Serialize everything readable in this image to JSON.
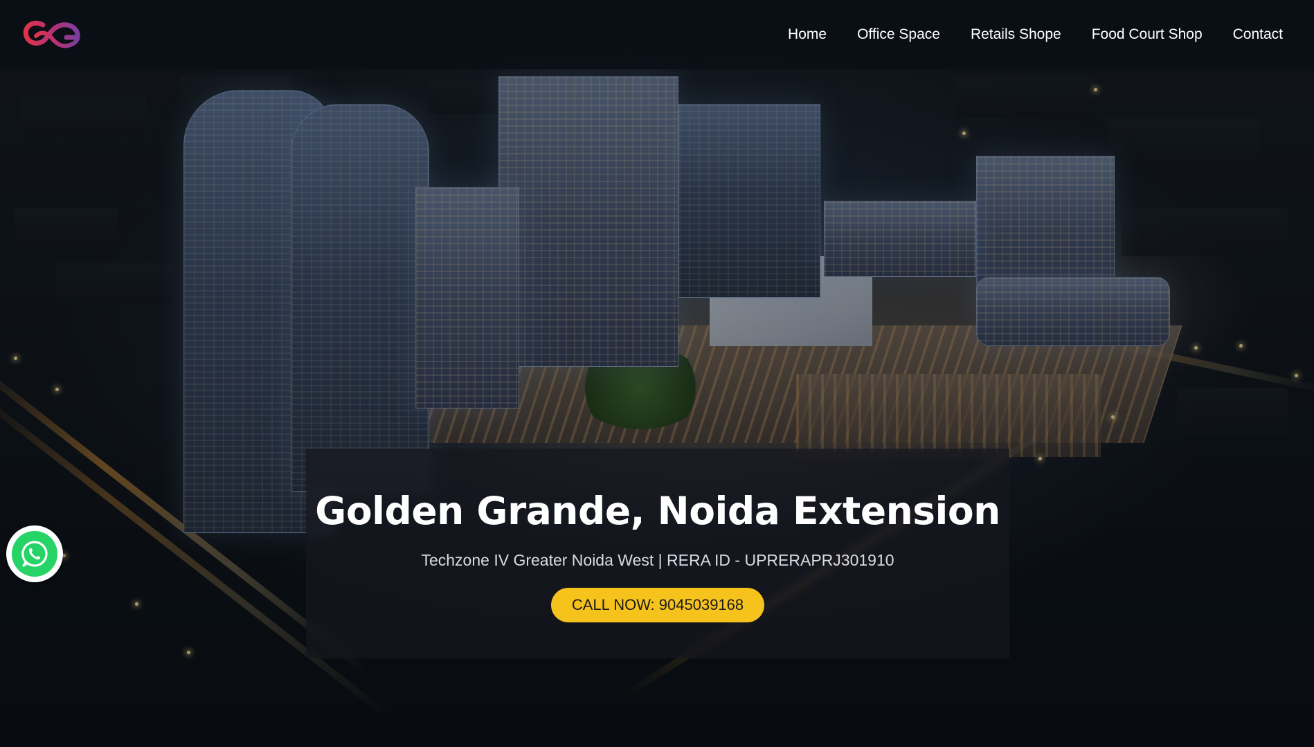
{
  "header": {
    "logo_name": "gg-logo",
    "nav": [
      {
        "label": "Home"
      },
      {
        "label": "Office Space"
      },
      {
        "label": "Retails Shope"
      },
      {
        "label": "Food Court Shop"
      },
      {
        "label": "Contact"
      }
    ]
  },
  "hero": {
    "title": "Golden Grande, Noida Extension",
    "subtitle": "Techzone IV Greater Noida West | RERA ID - UPRERAPRJ301910",
    "cta_label": "CALL NOW: 9045039168"
  },
  "floating": {
    "whatsapp_icon": "whatsapp-icon"
  },
  "colors": {
    "cta_background": "#f6c21c",
    "header_background": "#0a0f16",
    "whatsapp_green": "#25d366",
    "logo_red": "#e0334b",
    "logo_purple": "#7b3fa0"
  }
}
